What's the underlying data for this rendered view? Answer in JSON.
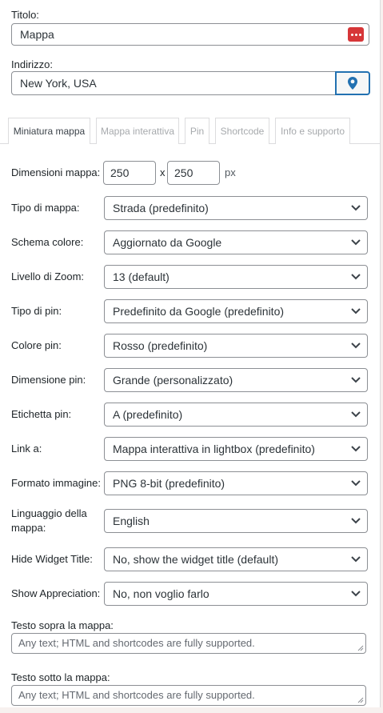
{
  "title_field": {
    "label": "Titolo:",
    "value": "Mappa"
  },
  "address_field": {
    "label": "Indirizzo:",
    "value": "New York, USA"
  },
  "tabs": [
    {
      "label": "Miniatura mappa",
      "active": true
    },
    {
      "label": "Mappa interattiva",
      "active": false
    },
    {
      "label": "Pin",
      "active": false
    },
    {
      "label": "Shortcode",
      "active": false
    },
    {
      "label": "Info e supporto",
      "active": false
    }
  ],
  "dimensions": {
    "label": "Dimensioni mappa:",
    "width": "250",
    "separator": "x",
    "height": "250",
    "unit": "px"
  },
  "settings": [
    {
      "label": "Tipo di mappa:",
      "value": "Strada (predefinito)"
    },
    {
      "label": "Schema colore:",
      "value": "Aggiornato da Google"
    },
    {
      "label": "Livello di Zoom:",
      "value": "13 (default)"
    },
    {
      "label": "Tipo di pin:",
      "value": "Predefinito da Google (predefinito)"
    },
    {
      "label": "Colore pin:",
      "value": "Rosso (predefinito)"
    },
    {
      "label": "Dimensione pin:",
      "value": "Grande (personalizzato)"
    },
    {
      "label": "Etichetta pin:",
      "value": "A (predefinito)"
    },
    {
      "label": "Link a:",
      "value": "Mappa interattiva in lightbox (predefinito)"
    },
    {
      "label": "Formato immagine:",
      "value": "PNG 8-bit (predefinito)"
    },
    {
      "label_line1": "Linguaggio della",
      "label_line2": "mappa:",
      "value": "English"
    },
    {
      "label": "Hide Widget Title:",
      "value": "No, show the widget title (default)"
    },
    {
      "label": "Show Appreciation:",
      "value": "No, non voglio farlo"
    }
  ],
  "text_above": {
    "label": "Testo sopra la mappa:",
    "placeholder": "Any text; HTML and shortcodes are fully supported."
  },
  "text_below": {
    "label": "Testo sotto la mappa:",
    "placeholder": "Any text; HTML and shortcodes are fully supported."
  },
  "colors": {
    "accent": "#2271b1",
    "dots_badge": "#d63638"
  }
}
